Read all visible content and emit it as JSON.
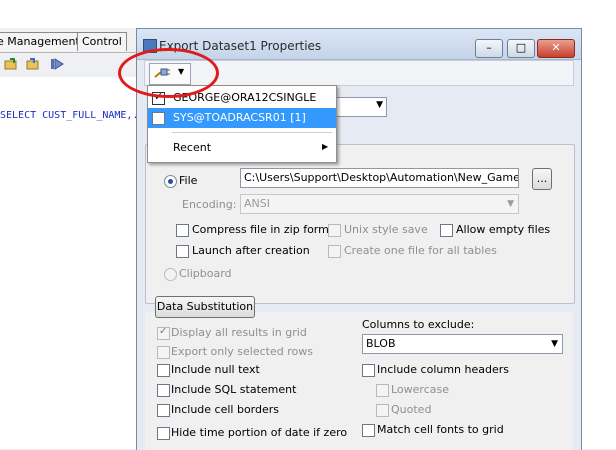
{
  "background": {
    "tabs": [
      "e Management",
      "Control"
    ],
    "sql_text": "SELECT CUST_FULL_NAME,."
  },
  "dialog": {
    "title": "Export Dataset1 Properties",
    "window_buttons": {
      "minimize": "–",
      "maximize": "□",
      "close": "✕"
    }
  },
  "connection_menu": {
    "items": [
      {
        "label": "GEORGE@ORA12CSINGLE",
        "checked": true
      },
      {
        "label": "SYS@TOADRACSR01 [1]",
        "checked": false,
        "highlighted": true
      }
    ],
    "recent_label": "Recent"
  },
  "output": {
    "file_label": "File",
    "file_path": "C:\\Users\\Support\\Desktop\\Automation\\New_Gamers.xlsx",
    "browse_label": "...",
    "encoding_label": "Encoding:",
    "encoding_value": "ANSI",
    "options": {
      "compress": "Compress file in zip format",
      "unix": "Unix style save",
      "allow_empty": "Allow empty files",
      "launch": "Launch after creation",
      "one_file": "Create one file for all tables"
    },
    "clipboard_label": "Clipboard"
  },
  "lower": {
    "data_substitution": "Data Substitution",
    "display_all": "Display all results in grid",
    "export_selected": "Export only selected rows",
    "include_null": "Include null text",
    "include_sql": "Include SQL statement",
    "include_borders": "Include cell borders",
    "hide_time": "Hide time portion of date if zero",
    "columns_exclude_label": "Columns to exclude:",
    "columns_exclude_value": "BLOB",
    "include_headers": "Include column headers",
    "lowercase": "Lowercase",
    "quoted": "Quoted",
    "match_fonts": "Match cell fonts to grid"
  },
  "colors": {
    "highlight": "#3399ff",
    "annotation_circle": "#e01b1b",
    "sql_text": "#1a2cc2"
  }
}
